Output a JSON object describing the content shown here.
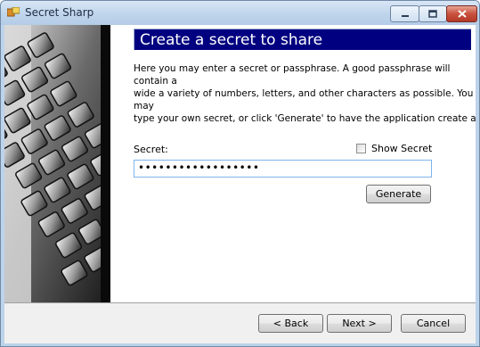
{
  "window": {
    "title": "Secret Sharp",
    "accent": "#000080"
  },
  "wizard": {
    "header": "Create a secret to share",
    "description": "Here you may enter a secret or passphrase. A good passphrase will contain a\nwide a variety of numbers, letters, and other characters as possible. You may\ntype your own secret, or click 'Generate' to have the application create a",
    "secret_label": "Secret:",
    "secret_value": "••••••••••••••••••",
    "show_secret_label": "Show Secret",
    "show_secret_checked": false,
    "generate_label": "Generate"
  },
  "footer": {
    "back_label": "< Back",
    "next_label": "Next >",
    "cancel_label": "Cancel"
  },
  "icons": {
    "app": "app-icon",
    "minimize": "minimize-icon",
    "maximize": "maximize-icon",
    "close": "close-icon"
  }
}
